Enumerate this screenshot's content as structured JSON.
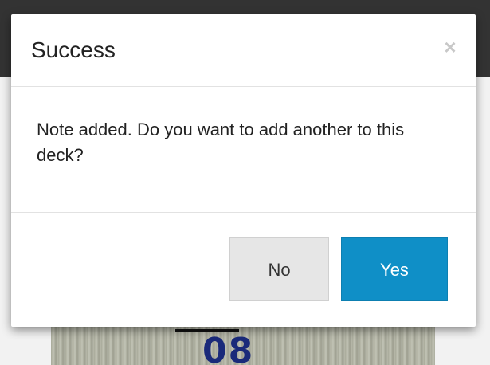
{
  "dialog": {
    "title": "Success",
    "close_glyph": "×",
    "message": "Note added. Do you want to add another to this deck?",
    "buttons": {
      "no_label": "No",
      "yes_label": "Yes"
    }
  },
  "background": {
    "photo_text": "08"
  },
  "colors": {
    "primary_button": "#0f8fc7",
    "secondary_button": "#e6e6e6",
    "top_bar": "#333333"
  },
  "icons": {
    "close": "close-icon"
  }
}
